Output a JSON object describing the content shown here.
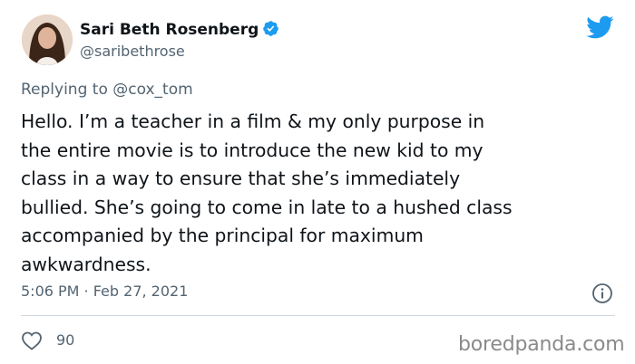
{
  "author": {
    "display_name": "Sari Beth Rosenberg",
    "handle": "@saribethrose",
    "verified": true
  },
  "reply": {
    "prefix": "Replying to ",
    "mention": "@cox_tom"
  },
  "tweet": {
    "text": "Hello. I’m a teacher in a film & my only purpose in\nthe entire movie is to introduce the new kid to my\nclass in a way to ensure that she’s immediately\nbullied. She’s going to come in late to a hushed class\naccompanied by the principal for maximum\nawkwardness.",
    "timestamp": "5:06 PM · Feb 27, 2021",
    "likes": "90"
  },
  "icons": {
    "brand": "twitter-bird-icon",
    "verified": "verified-badge-icon",
    "info": "info-icon",
    "like": "heart-icon"
  },
  "colors": {
    "twitter_blue": "#1d9bf0",
    "secondary_text": "#536471",
    "primary_text": "#0f1419"
  },
  "watermark": "boredpanda.com"
}
